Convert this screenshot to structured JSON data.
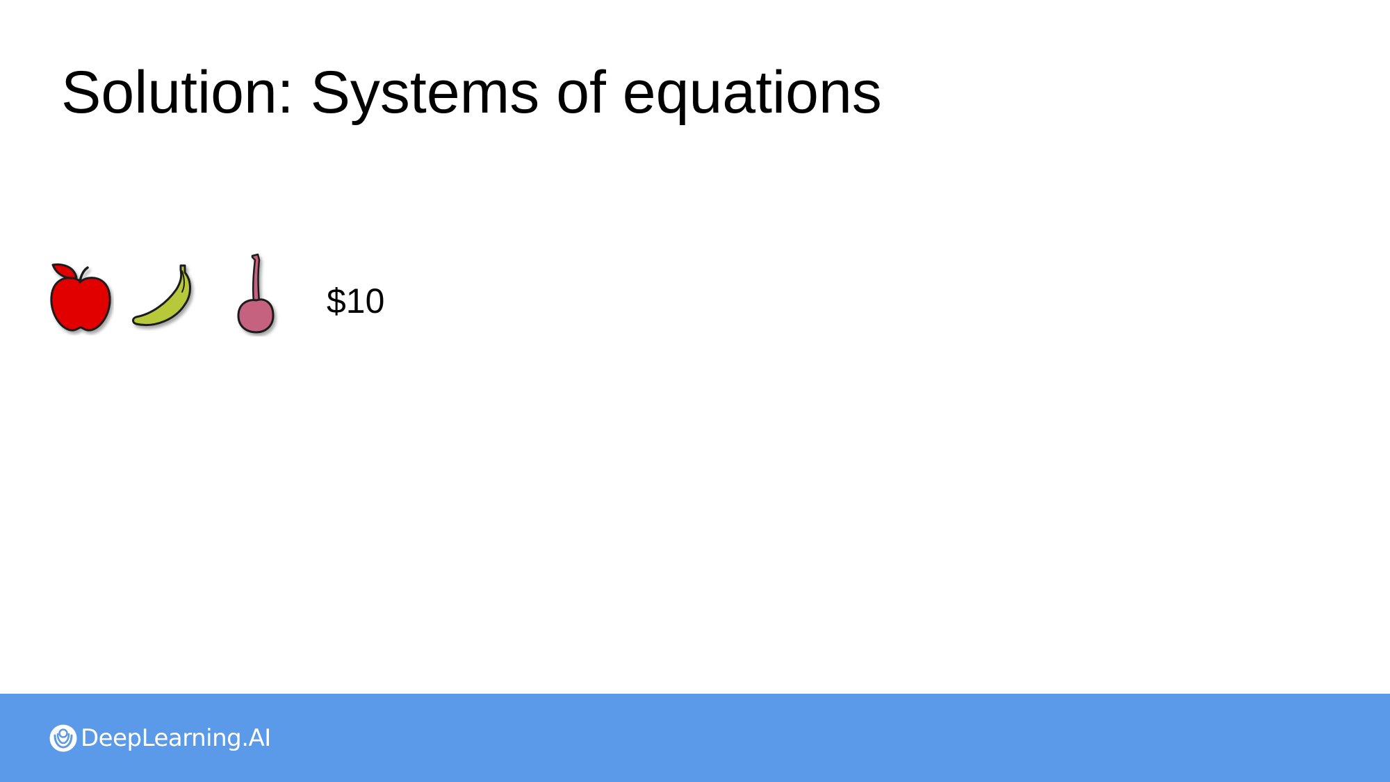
{
  "slide": {
    "title": "Solution: Systems of equations",
    "background_color": "#ffffff"
  },
  "equation": {
    "items": [
      {
        "icon": "apple-icon",
        "color": "#e00000"
      },
      {
        "icon": "banana-icon",
        "color": "#b7c93a"
      },
      {
        "icon": "cherry-icon",
        "color": "#c4627f"
      }
    ],
    "total": "$10"
  },
  "footer": {
    "brand": "DeepLearning.AI",
    "logo_icon": "deeplearning-logo-icon",
    "background_color": "#5b9ae8"
  }
}
